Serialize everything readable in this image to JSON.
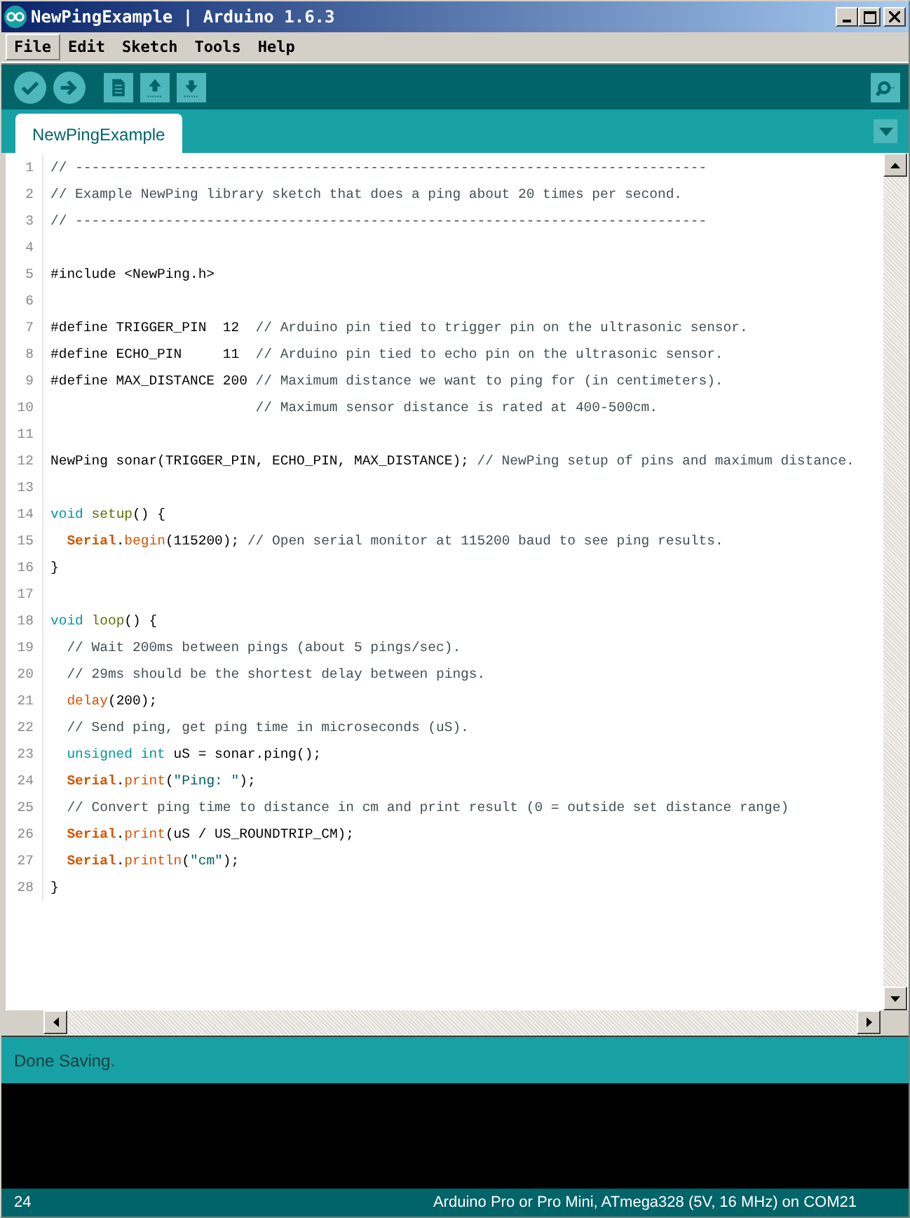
{
  "window": {
    "title": "NewPingExample | Arduino 1.6.3"
  },
  "menu": [
    {
      "label": "File",
      "selected": true
    },
    {
      "label": "Edit",
      "selected": false
    },
    {
      "label": "Sketch",
      "selected": false
    },
    {
      "label": "Tools",
      "selected": false
    },
    {
      "label": "Help",
      "selected": false
    }
  ],
  "toolbar": [
    {
      "kind": "verify"
    },
    {
      "kind": "upload"
    },
    {
      "kind": "new"
    },
    {
      "kind": "open"
    },
    {
      "kind": "save"
    },
    {
      "kind": "monitor"
    }
  ],
  "tabs": [
    {
      "label": "NewPingExample",
      "selected": true
    }
  ],
  "editor": {
    "lines": [
      {
        "number": "1",
        "tokens": [
          {
            "kind": "comment",
            "text": "// -----------------------------------------------------------------------------"
          }
        ]
      },
      {
        "number": "2",
        "tokens": [
          {
            "kind": "comment",
            "text": "// Example NewPing library sketch that does a ping about 20 times per second."
          }
        ]
      },
      {
        "number": "3",
        "tokens": [
          {
            "kind": "comment",
            "text": "// -----------------------------------------------------------------------------"
          }
        ]
      },
      {
        "number": "4"
      },
      {
        "number": "5",
        "tokens": [
          {
            "kind": "plain",
            "text": "#include <NewPing.h>"
          }
        ]
      },
      {
        "number": "6"
      },
      {
        "number": "7",
        "tokens": [
          {
            "kind": "plain",
            "text": "#define TRIGGER_PIN  12  "
          },
          {
            "kind": "comment",
            "text": "// Arduino pin tied to trigger pin on the ultrasonic sensor."
          }
        ]
      },
      {
        "number": "8",
        "tokens": [
          {
            "kind": "plain",
            "text": "#define ECHO_PIN     11  "
          },
          {
            "kind": "comment",
            "text": "// Arduino pin tied to echo pin on the ultrasonic sensor."
          }
        ]
      },
      {
        "number": "9",
        "tokens": [
          {
            "kind": "plain",
            "text": "#define MAX_DISTANCE 200 "
          },
          {
            "kind": "comment",
            "text": "// Maximum distance we want to ping for (in centimeters)."
          }
        ]
      },
      {
        "number": "10",
        "tokens": [
          {
            "kind": "comment",
            "text": "                         // Maximum sensor distance is rated at 400-500cm."
          }
        ]
      },
      {
        "number": "11"
      },
      {
        "number": "12",
        "tokens": [
          {
            "kind": "plain",
            "text": "NewPing sonar(TRIGGER_PIN, ECHO_PIN, MAX_DISTANCE); "
          },
          {
            "kind": "comment",
            "text": "// NewPing setup of pins and maximum distance."
          }
        ]
      },
      {
        "number": "13"
      },
      {
        "number": "14",
        "tokens": [
          {
            "kind": "keyword",
            "text": "void "
          },
          {
            "kind": "function",
            "text": "setup"
          },
          {
            "kind": "plain",
            "text": "() {"
          }
        ]
      },
      {
        "number": "15",
        "tokens": [
          {
            "kind": "class",
            "text": "  Serial"
          },
          {
            "kind": "plain",
            "text": "."
          },
          {
            "kind": "method",
            "text": "begin"
          },
          {
            "kind": "plain",
            "text": "(115200); "
          },
          {
            "kind": "comment",
            "text": "// Open serial monitor at 115200 baud to see ping results."
          }
        ]
      },
      {
        "number": "16",
        "tokens": [
          {
            "kind": "plain",
            "text": "}"
          }
        ]
      },
      {
        "number": "17"
      },
      {
        "number": "18",
        "tokens": [
          {
            "kind": "keyword",
            "text": "void "
          },
          {
            "kind": "function",
            "text": "loop"
          },
          {
            "kind": "plain",
            "text": "() {"
          }
        ]
      },
      {
        "number": "19",
        "tokens": [
          {
            "kind": "comment",
            "text": "  // Wait 200ms between pings (about 5 pings/sec)."
          }
        ]
      },
      {
        "number": "20",
        "tokens": [
          {
            "kind": "comment",
            "text": "  // 29ms should be the shortest delay between pings."
          }
        ]
      },
      {
        "number": "21",
        "tokens": [
          {
            "kind": "method",
            "text": "  delay"
          },
          {
            "kind": "plain",
            "text": "(200);"
          }
        ]
      },
      {
        "number": "22",
        "tokens": [
          {
            "kind": "comment",
            "text": "  // Send ping, get ping time in microseconds (uS)."
          }
        ]
      },
      {
        "number": "23",
        "tokens": [
          {
            "kind": "keyword",
            "text": "  unsigned int"
          },
          {
            "kind": "plain",
            "text": " uS = sonar.ping();"
          }
        ]
      },
      {
        "number": "24",
        "tokens": [
          {
            "kind": "class",
            "text": "  Serial"
          },
          {
            "kind": "plain",
            "text": "."
          },
          {
            "kind": "method",
            "text": "print"
          },
          {
            "kind": "plain",
            "text": "("
          },
          {
            "kind": "string",
            "text": "\"Ping: \""
          },
          {
            "kind": "plain",
            "text": ");"
          }
        ]
      },
      {
        "number": "25",
        "tokens": [
          {
            "kind": "comment",
            "text": "  // Convert ping time to distance in cm and print result (0 = outside set distance range)"
          }
        ]
      },
      {
        "number": "26",
        "tokens": [
          {
            "kind": "class",
            "text": "  Serial"
          },
          {
            "kind": "plain",
            "text": "."
          },
          {
            "kind": "method",
            "text": "print"
          },
          {
            "kind": "plain",
            "text": "(uS / US_ROUNDTRIP_CM);"
          }
        ]
      },
      {
        "number": "27",
        "tokens": [
          {
            "kind": "class",
            "text": "  Serial"
          },
          {
            "kind": "plain",
            "text": "."
          },
          {
            "kind": "method",
            "text": "println"
          },
          {
            "kind": "plain",
            "text": "("
          },
          {
            "kind": "string",
            "text": "\"cm\""
          },
          {
            "kind": "plain",
            "text": ");"
          }
        ]
      },
      {
        "number": "28",
        "tokens": [
          {
            "kind": "plain",
            "text": "}"
          }
        ]
      }
    ]
  },
  "status": {
    "message": "Done Saving."
  },
  "status_bar": {
    "line": "24",
    "board": "Arduino Pro or Pro Mini, ATmega328 (5V, 16 MHz) on COM21"
  }
}
